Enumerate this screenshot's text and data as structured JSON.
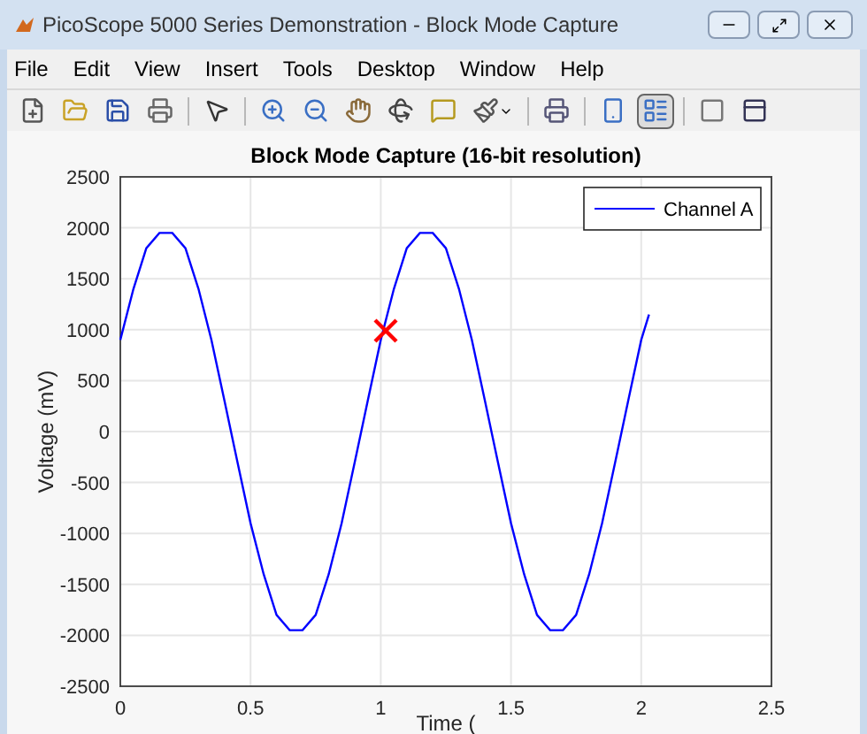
{
  "window": {
    "title": "PicoScope 5000 Series Demonstration - Block Mode Capture"
  },
  "menu": [
    "File",
    "Edit",
    "View",
    "Insert",
    "Tools",
    "Desktop",
    "Window",
    "Help"
  ],
  "toolbar": [
    {
      "kind": "new",
      "pressed": false
    },
    {
      "kind": "open",
      "pressed": false
    },
    {
      "kind": "save",
      "pressed": false
    },
    {
      "kind": "print",
      "pressed": false
    },
    {
      "kind": "sep"
    },
    {
      "kind": "pointer",
      "pressed": false
    },
    {
      "kind": "sep"
    },
    {
      "kind": "zoom-in",
      "pressed": false
    },
    {
      "kind": "zoom-out",
      "pressed": false
    },
    {
      "kind": "pan",
      "pressed": false
    },
    {
      "kind": "rotate",
      "pressed": false
    },
    {
      "kind": "cursor",
      "pressed": false
    },
    {
      "kind": "brush",
      "pressed": false
    },
    {
      "kind": "sep"
    },
    {
      "kind": "link",
      "pressed": false
    },
    {
      "kind": "sep"
    },
    {
      "kind": "colorbar",
      "pressed": false
    },
    {
      "kind": "legend",
      "pressed": true
    },
    {
      "kind": "sep"
    },
    {
      "kind": "hide",
      "pressed": false
    },
    {
      "kind": "show",
      "pressed": false
    }
  ],
  "figure": {
    "chart_data": {
      "type": "line",
      "title": "Block Mode Capture (16-bit resolution)",
      "xlabel": "Time (",
      "ylabel": "Voltage (mV)",
      "x": [
        0,
        0.05,
        0.1,
        0.15,
        0.2,
        0.25,
        0.3,
        0.35,
        0.4,
        0.45,
        0.5,
        0.55,
        0.6,
        0.65,
        0.7,
        0.75,
        0.8,
        0.85,
        0.9,
        0.95,
        1,
        1.05,
        1.1,
        1.15,
        1.2,
        1.25,
        1.3,
        1.35,
        1.4,
        1.45,
        1.5,
        1.55,
        1.6,
        1.65,
        1.7,
        1.75,
        1.8,
        1.85,
        1.9,
        1.95,
        2,
        2.03
      ],
      "series": [
        {
          "name": "Channel A",
          "color": "#0000ff",
          "values": [
            900,
            1400,
            1800,
            1950,
            1950,
            1800,
            1400,
            900,
            300,
            -300,
            -900,
            -1400,
            -1800,
            -1950,
            -1950,
            -1800,
            -1400,
            -900,
            -300,
            300,
            900,
            1400,
            1800,
            1950,
            1950,
            1800,
            1400,
            900,
            300,
            -300,
            -900,
            -1400,
            -1800,
            -1950,
            -1950,
            -1800,
            -1400,
            -900,
            -300,
            300,
            900,
            1150
          ]
        }
      ],
      "grid": true,
      "xlim": [
        0,
        2.5
      ],
      "ylim": [
        -2500,
        2500
      ],
      "xticks": [
        0,
        0.5,
        1,
        1.5,
        2,
        2.5
      ],
      "yticks": [
        -2500,
        -2000,
        -1500,
        -1000,
        -500,
        0,
        500,
        1000,
        1500,
        2000,
        2500
      ]
    }
  }
}
